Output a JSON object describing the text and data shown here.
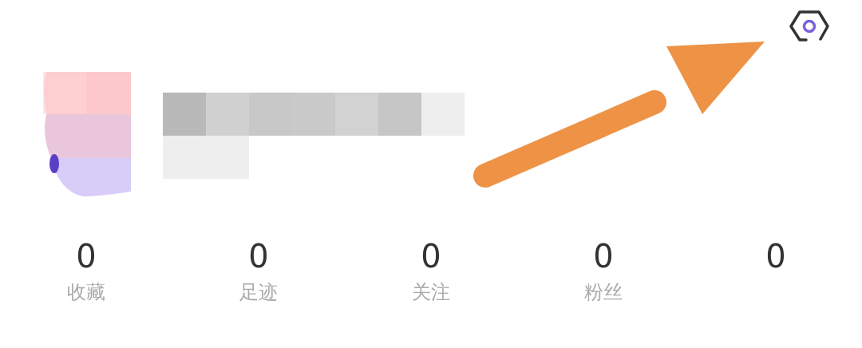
{
  "stats": [
    {
      "value": "0",
      "label": "收藏"
    },
    {
      "value": "0",
      "label": "足迹"
    },
    {
      "value": "0",
      "label": "关注"
    },
    {
      "value": "0",
      "label": "粉丝"
    },
    {
      "value": "0"
    }
  ]
}
